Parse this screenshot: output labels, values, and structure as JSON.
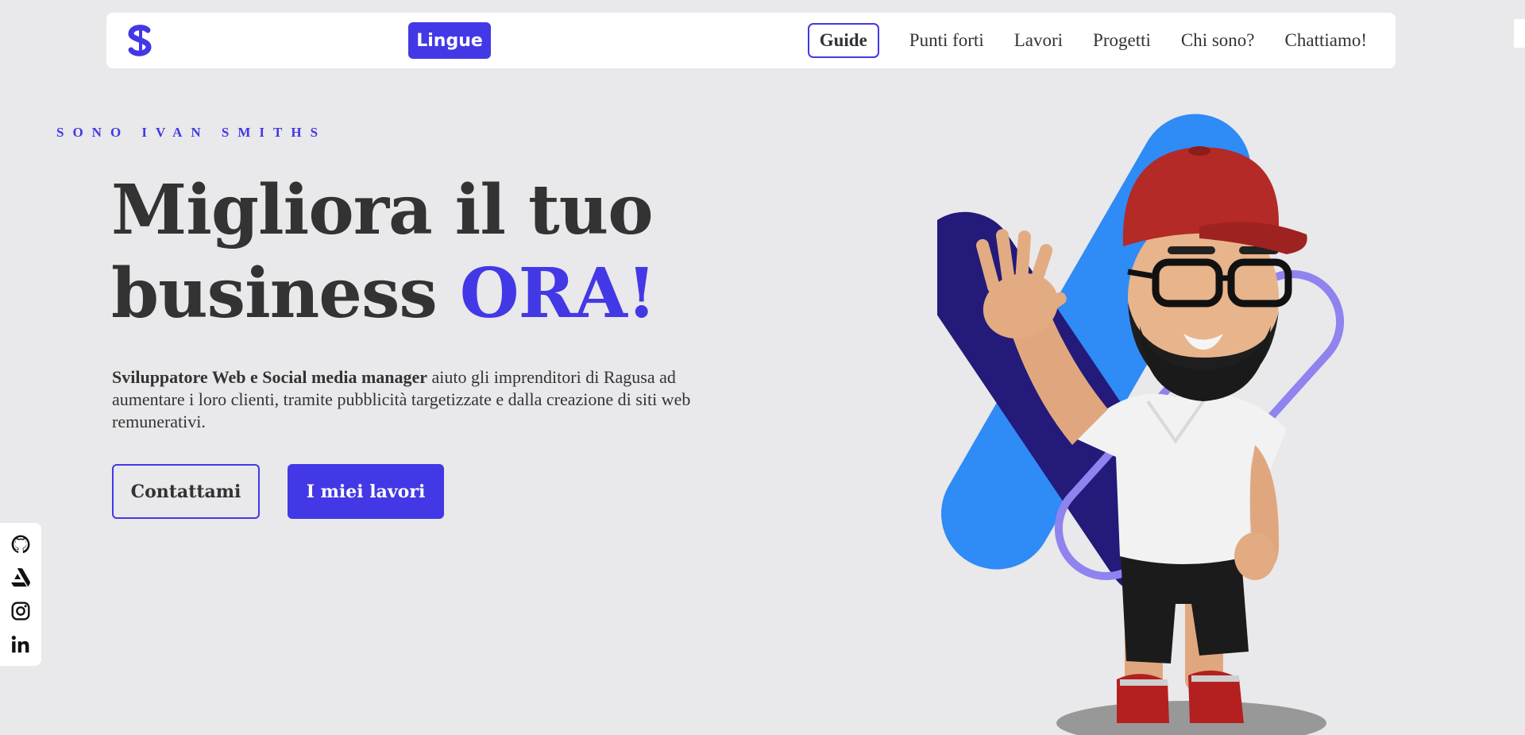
{
  "header": {
    "logo_icon": "brand-s-logo",
    "language_button": "Lingue",
    "nav": [
      {
        "label": "Guide",
        "active": true
      },
      {
        "label": "Punti forti",
        "active": false
      },
      {
        "label": "Lavori",
        "active": false
      },
      {
        "label": "Progetti",
        "active": false
      },
      {
        "label": "Chi sono?",
        "active": false
      },
      {
        "label": "Chattiamo!",
        "active": false
      }
    ]
  },
  "hero": {
    "eyebrow": "SONO IVAN SMITHS",
    "headline_part1": "Migliora il tuo",
    "headline_part2": "business ",
    "headline_accent": "ORA!",
    "intro_bold": "Sviluppatore Web e Social media manager",
    "intro_rest": " aiuto gli imprenditori di Ragusa ad aumentare i loro clienti, tramite pubblicità targetizzate e dalla creazione di siti web remunerativi.",
    "button_contact": "Contattami",
    "button_works": "I miei lavori"
  },
  "social": [
    {
      "icon": "github-icon"
    },
    {
      "icon": "artstation-icon"
    },
    {
      "icon": "instagram-icon"
    },
    {
      "icon": "linkedin-icon"
    }
  ],
  "colors": {
    "accent": "#4338e6",
    "background": "#e9e8ea",
    "text": "#333333",
    "shape_blue": "#2f8bf5",
    "shape_navy": "#231a7a",
    "shape_lilac": "#8f83ef"
  }
}
